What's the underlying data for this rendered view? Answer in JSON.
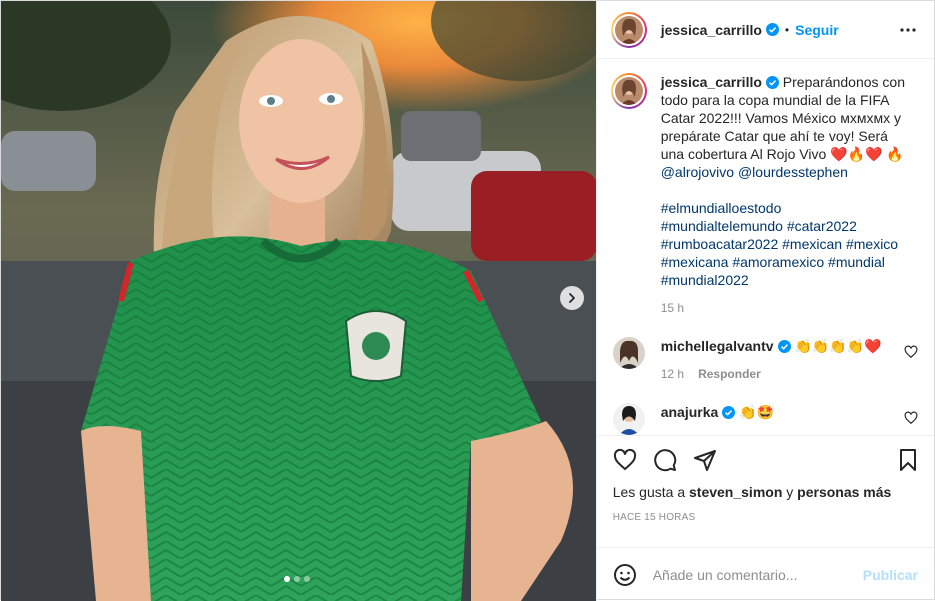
{
  "post": {
    "author": "jessica_carrillo",
    "follow_label": "Seguir",
    "separator": "•"
  },
  "caption": {
    "username": "jessica_carrillo",
    "text": "Preparándonos con todo para la copa mundial de la FIFA Catar 2022!!! Vamos México ᴍxᴍxᴍx y prepárate Catar que ahí te voy! Será una cobertura Al Rojo Vivo ❤️🔥❤️ 🔥",
    "mention_1": "@alrojovivo",
    "mention_2": "@lourdesstephen",
    "hashtags": [
      "#elmundialloestodo",
      "#mundialtelemundo",
      "#catar2022",
      "#rumboacatar2022",
      "#mexican",
      "#mexico",
      "#mexicana",
      "#amoramexico",
      "#mundial",
      "#mundial2022"
    ],
    "time": "15 h"
  },
  "comments": [
    {
      "username": "michellegalvantv",
      "text": "👏👏👏👏❤️",
      "time": "12 h",
      "reply_label": "Responder"
    },
    {
      "username": "anajurka",
      "text": "👏🤩"
    }
  ],
  "likes": {
    "prefix": "Les gusta a",
    "user": "steven_simon",
    "conjunction": "y",
    "others": "personas más"
  },
  "posted_ago": "HACE 15 HORAS",
  "comment_box": {
    "placeholder": "Añade un comentario...",
    "post_label": "Publicar"
  },
  "carousel": {
    "slides": 3,
    "active": 1
  },
  "icons": {
    "verified": "verified-badge-icon",
    "more": "more-options-icon",
    "heart": "heart-icon",
    "comment": "comment-icon",
    "share": "share-icon",
    "save": "bookmark-icon",
    "emoji": "emoji-icon",
    "next": "chevron-right-icon"
  },
  "colors": {
    "accent": "#0095f6",
    "link": "#00376b",
    "muted": "#8e8e8e",
    "post_disabled": "#b2dffc",
    "jersey": "#2ea55a"
  }
}
